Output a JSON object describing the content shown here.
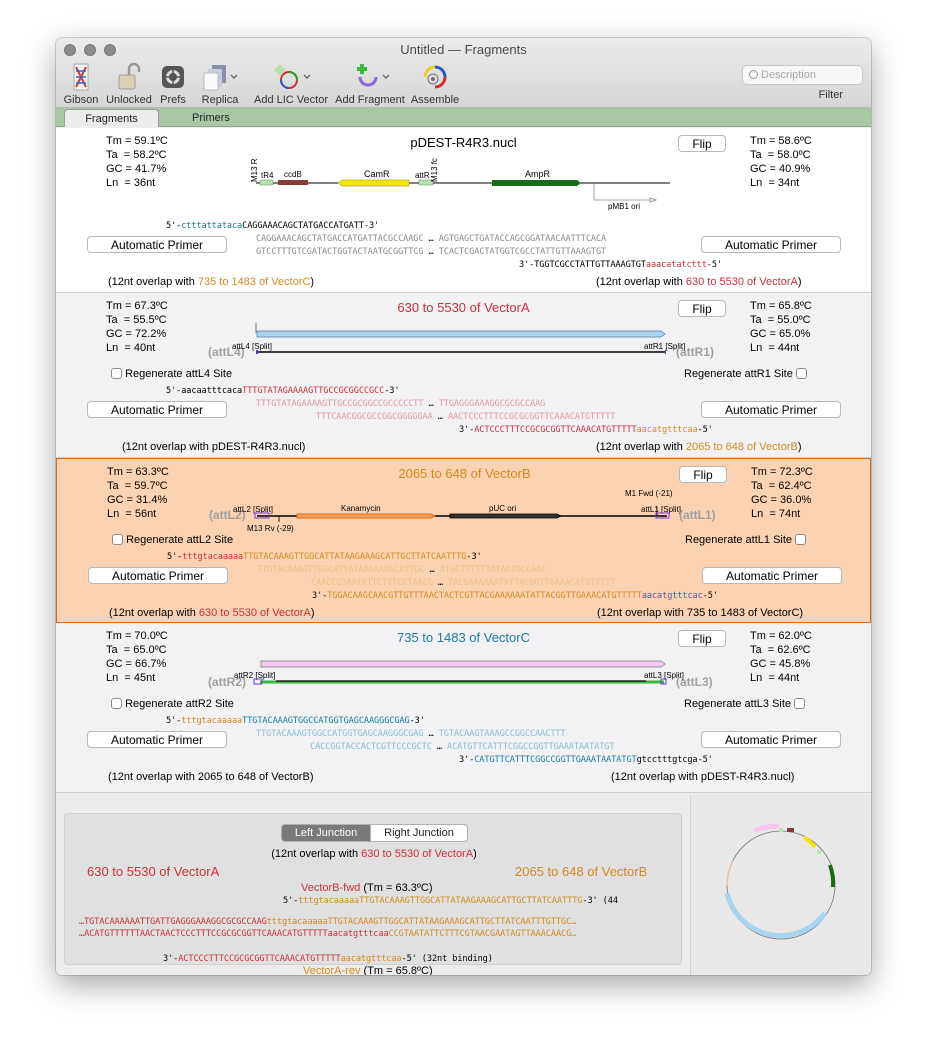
{
  "window": {
    "title": "Untitled — Fragments"
  },
  "toolbar": {
    "items": [
      {
        "label": "Gibson",
        "icon": "gibson-icon"
      },
      {
        "label": "Unlocked",
        "icon": "unlocked-padlock-icon"
      },
      {
        "label": "Prefs",
        "icon": "prefs-gear-icon"
      },
      {
        "label": "Replica",
        "icon": "replica-icon",
        "has_menu": true
      },
      {
        "label": "Add LIC Vector",
        "icon": "add-lic-vector-icon",
        "has_menu": true
      },
      {
        "label": "Add Fragment",
        "icon": "add-fragment-icon",
        "has_menu": true
      },
      {
        "label": "Assemble",
        "icon": "assemble-icon"
      }
    ],
    "search_placeholder": "Description",
    "filter_label": "Filter"
  },
  "tabs": [
    {
      "label": "Fragments",
      "active": true
    },
    {
      "label": "Primers",
      "active": false
    }
  ],
  "colors": {
    "vectorA": "#c8323a",
    "vectorB": "#d38b1e",
    "vectorC": "#1e7aa0",
    "selected_bg": "#fbd2b2",
    "tab_green": "#a8c8a4"
  },
  "fragments": [
    {
      "title": "pDEST-R4R3.nucl",
      "left_stats": {
        "tm": "Tm = 59.1ºC",
        "ta": "Ta  = 58.2ºC",
        "gc": "GC = 41.7%",
        "ln": "Ln  = 36nt"
      },
      "right_stats": {
        "tm": "Tm = 58.6ºC",
        "ta": "Ta  = 58.0ºC",
        "gc": "GC = 40.9%",
        "ln": "Ln  = 34nt"
      },
      "flip_label": "Flip",
      "auto_primer_label": "Automatic Primer",
      "features": [
        "M13 R",
        "tR4",
        "ccdB",
        "CamR",
        "attR",
        "M13 fc",
        "AmpR",
        "pMB1 ori"
      ],
      "fwd_primer": {
        "prefix": "5'-",
        "tail": "ctttattataca",
        "body": "CAGGAAACAGCTATGACCATGATT",
        "suffix": "-3'"
      },
      "top_strand_left": "CAGGAAACAGCTATGACCATGATTACGCCAAGC",
      "top_strand_right": "AGTGAGCTGATACCAGCGGATAACAATTTCACA",
      "bot_strand_left": "GTCCTTTGTCGATACTGGTACTAATGCGGTTCG",
      "bot_strand_right": "TCACTCGACTATGGTCGCCTATTGTTAAAGTGT",
      "ellipsis": "…",
      "rev_primer": {
        "prefix": "3'-",
        "body": "TGGTCGCCTATTGTTAAAGTGT",
        "tail": "aaacatatcttt",
        "suffix": "-5'"
      },
      "left_overlap": {
        "pre": "(12nt overlap with ",
        "name": "735 to 1483 of VectorC",
        "post": ")"
      },
      "right_overlap": {
        "pre": "(12nt overlap with ",
        "name": "630 to 5530 of VectorA",
        "post": ")"
      }
    },
    {
      "title": "630 to 5530 of VectorA",
      "left_stats": {
        "tm": "Tm = 67.3ºC",
        "ta": "Ta  = 55.5ºC",
        "gc": "GC = 72.2%",
        "ln": "Ln  = 40nt"
      },
      "right_stats": {
        "tm": "Tm = 65.8ºC",
        "ta": "Ta  = 55.0ºC",
        "gc": "GC = 65.0%",
        "ln": "Ln  = 44nt"
      },
      "flip_label": "Flip",
      "auto_primer_label": "Automatic Primer",
      "left_site": "attL4 [Split]",
      "left_site_ghost": "(attL4)",
      "right_site": "attR1 [Split]",
      "right_site_ghost": "(attR1)",
      "regen_left": {
        "label": "Regenerate attL4 Site",
        "checked": false
      },
      "regen_right": {
        "label": "Regenerate attR1 Site",
        "checked": false
      },
      "fwd_primer": {
        "prefix": "5'-",
        "tail": "aacaatttcaca",
        "body": "TTTGTATAGAAAAGTTGCCGCGGCCGCC",
        "suffix": "-3'"
      },
      "top_strand_left": "TTTGTATAGAAAAGTTGCCGCGGCCGCCCCCTT",
      "top_strand_right": "TTGAGGGAAAGGCGCGCCAAG",
      "bot_strand_left": "TTTCAACGGCGCCGGCGGGGGAA",
      "bot_strand_right": "AACTCCCTTTCCGCGCGGTTCAAACATGTTTTT",
      "ellipsis": "…",
      "rev_primer": {
        "prefix": "3'-",
        "body": "ACTCCCTTTCCGCGCGGTTCAAACATGTTTTT",
        "tail": "aacatgtttcaa",
        "suffix": "-5'"
      },
      "left_overlap": {
        "pre": "(12nt overlap with ",
        "name": "pDEST-R4R3.nucl",
        "post": ")"
      },
      "right_overlap": {
        "pre": "(12nt overlap with ",
        "name": "2065 to 648 of VectorB",
        "post": ")"
      }
    },
    {
      "title": "2065 to 648 of VectorB",
      "selected": true,
      "left_stats": {
        "tm": "Tm = 63.3ºC",
        "ta": "Ta  = 59.7ºC",
        "gc": "GC = 31.4%",
        "ln": "Ln  = 56nt"
      },
      "right_stats": {
        "tm": "Tm = 72.3ºC",
        "ta": "Ta  = 62.4ºC",
        "gc": "GC = 36.0%",
        "ln": "Ln  = 74nt"
      },
      "flip_label": "Flip",
      "auto_primer_label": "Automatic Primer",
      "left_site": "attL2 [Split]",
      "left_site_ghost": "(attL2)",
      "right_site": "attL1 [Split]",
      "right_site_ghost": "(attL1)",
      "features": [
        "Kanamycin",
        "pUC ori",
        "M13 Rv (-29)",
        "M1 Fwd (-21)"
      ],
      "regen_left": {
        "label": "Regenerate attL2 Site",
        "checked": false
      },
      "regen_right": {
        "label": "Regenerate attL1 Site",
        "checked": false
      },
      "fwd_primer": {
        "prefix": "5'-",
        "tail": "tttgtacaaaaa",
        "body": "TTGTACAAAGTTGGCATTATAAGAAAGCATTGCTTATCAATTTG",
        "suffix": "-3'"
      },
      "top_strand_left": "TTGTACAAAGTTGGCATTATAAGAAAGCATTGC",
      "top_strand_right": "ATGCTTTTTTATAATGCCAAC",
      "bot_strand_left": "CAACCGTAATATTCTTTCGTAACG",
      "bot_strand_right": "TACGAAAAAATATTACGGTTGAAACATGTTTTT",
      "ellipsis": "…",
      "rev_primer": {
        "prefix": "3'-",
        "body": "TGGACAAGCAACGTTGTTTAACTACTCGTTACGAAAAAATATTACGGTTGAAACATGTTTTT",
        "tail": "aacatgtttcac",
        "suffix": "-5'"
      },
      "left_overlap": {
        "pre": "(12nt overlap with ",
        "name": "630 to 5530 of VectorA",
        "post": ")"
      },
      "right_overlap": {
        "pre": "(12nt overlap with ",
        "name": "735 to 1483 of VectorC",
        "post": ")"
      }
    },
    {
      "title": "735 to 1483 of VectorC",
      "left_stats": {
        "tm": "Tm = 70.0ºC",
        "ta": "Ta  = 65.0ºC",
        "gc": "GC = 66.7%",
        "ln": "Ln  = 45nt"
      },
      "right_stats": {
        "tm": "Tm = 62.0ºC",
        "ta": "Ta  = 62.6ºC",
        "gc": "GC = 45.8%",
        "ln": "Ln  = 44nt"
      },
      "flip_label": "Flip",
      "auto_primer_label": "Automatic Primer",
      "left_site": "attR2 [Split]",
      "left_site_ghost": "(attR2)",
      "right_site": "attL3 [Split]",
      "right_site_ghost": "(attL3)",
      "regen_left": {
        "label": "Regenerate attR2 Site",
        "checked": false
      },
      "regen_right": {
        "label": "Regenerate attL3 Site",
        "checked": false
      },
      "fwd_primer": {
        "prefix": "5'-",
        "tail": "tttgtacaaaaa",
        "body": "TTGTACAAAGTGGCCATGGTGAGCAAGGGCGAG",
        "suffix": "-3'"
      },
      "top_strand_left": "TTGTACAAAGTGGCCATGGTGAGCAAGGGCGAG",
      "top_strand_right": "TGTACAAGTAAAGCCGGCCAACTTT",
      "bot_strand_left": "CACCGGTACCACTCGTTCCCGCTC",
      "bot_strand_right": "ACATGTTCATTTCGGCCGGTTGAAATAATATGT",
      "ellipsis": "…",
      "rev_primer": {
        "prefix": "3'-",
        "body": "CATGTTCATTTCGGCCGGTTGAAATAATATGT",
        "tail": "gtcctttgtcga",
        "suffix": "-5'"
      },
      "left_overlap": {
        "pre": "(12nt overlap with ",
        "name": "2065 to 648 of VectorB",
        "post": ")"
      },
      "right_overlap": {
        "pre": "(12nt overlap with ",
        "name": "pDEST-R4R3.nucl",
        "post": ")"
      }
    }
  ],
  "junction": {
    "segments": [
      {
        "label": "Left Junction",
        "active": true
      },
      {
        "label": "Right Junction",
        "active": false
      }
    ],
    "overlap": {
      "pre": "(12nt overlap with ",
      "name": "630 to 5530 of VectorA",
      "post": ")"
    },
    "left_name": "630 to 5530 of VectorA",
    "right_name": "2065 to 648 of VectorB",
    "fwd_primer_name": "VectorB-fwd",
    "fwd_primer_tm": " (Tm = 63.3ºC)",
    "fwd_seq": {
      "prefix": "5'-",
      "tail": "tttgtacaaaaa",
      "body": "TTGTACAAAGTTGGCATTATAAGAAAGCATTGCTTATCAATTTG",
      "suffix": "-3' (44"
    },
    "top": {
      "left": "…TGTACAAAAAATTGATTGAGGGAAAGGCGCGCCAAG",
      "mid": "tttgtacaaaaa",
      "right": "TTGTACAAAGTTGGCATTATAAGAAAGCATTGCTTATCAATTTGTTGC…"
    },
    "bottom": {
      "left": "…ACATGTTTTTTAACTAACTCCCTTTCCGCGCGGTTCAAACATGTTTTT",
      "mid": "aacatgtttcaa",
      "right": "CCGTAATATTCTTTCGTAACGAATAGTTAAACAACG…"
    },
    "rev_seq": {
      "prefix": "3'-",
      "body": "ACTCCCTTTCCGCGCGGTTCAAACATGTTTTT",
      "tail": "aacatgtttcaa",
      "suffix": "-5' (32nt binding)"
    },
    "rev_primer_name": "VectorA-rev",
    "rev_primer_tm": " (Tm = 65.8ºC)"
  }
}
